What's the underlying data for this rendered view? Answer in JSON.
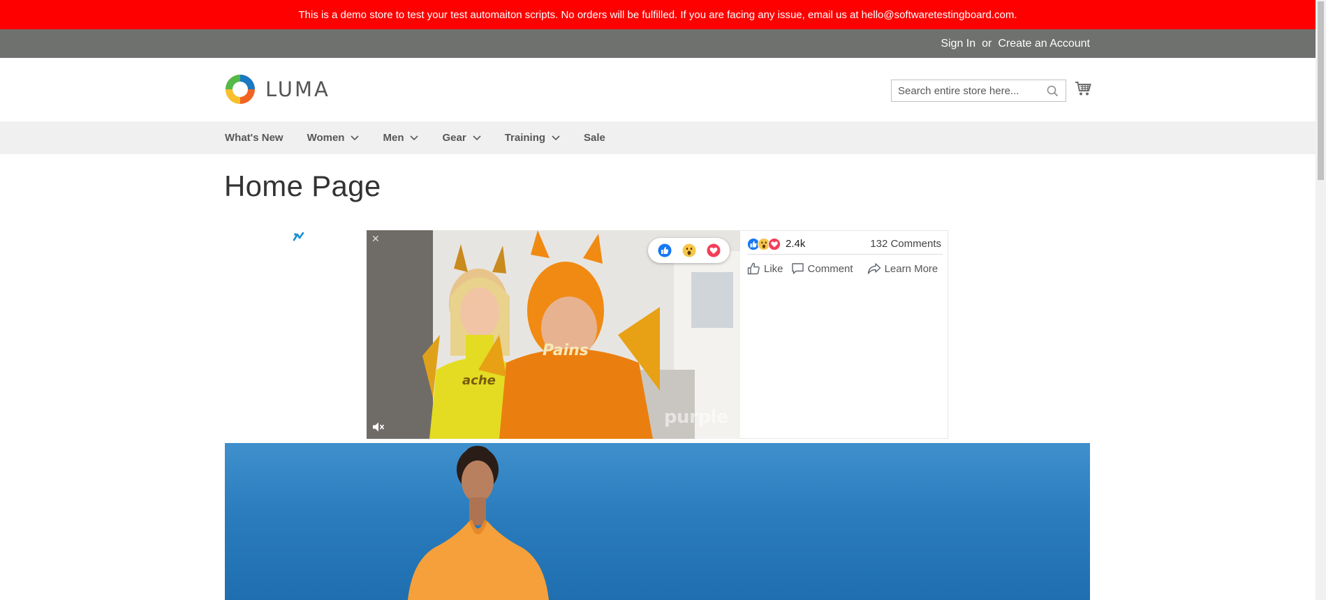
{
  "demo_banner": {
    "text": "This is a demo store to test your test automaiton scripts. No orders will be fulfilled. If you are facing any issue, email us at hello@softwaretestingboard.com."
  },
  "top_bar": {
    "sign_in": "Sign In",
    "or": "or",
    "create_account": "Create an Account"
  },
  "header": {
    "logo_text": "LUMA",
    "search_placeholder": "Search entire store here...",
    "search_value": ""
  },
  "nav": {
    "items": [
      {
        "label": "What's New",
        "has_dropdown": false
      },
      {
        "label": "Women",
        "has_dropdown": true
      },
      {
        "label": "Men",
        "has_dropdown": true
      },
      {
        "label": "Gear",
        "has_dropdown": true
      },
      {
        "label": "Training",
        "has_dropdown": true
      },
      {
        "label": "Sale",
        "has_dropdown": false
      }
    ]
  },
  "page": {
    "title": "Home Page"
  },
  "video_ad": {
    "close_glyph": "✕",
    "watermark": "purple",
    "shirt_left": "ache",
    "shirt_right": "Pains"
  },
  "social": {
    "reaction_count": "2.4k",
    "comments_count": "132 Comments",
    "actions": {
      "like": "Like",
      "comment": "Comment",
      "learn_more": "Learn More"
    }
  },
  "colors": {
    "banner_red": "#ff0000",
    "top_bar_gray": "#6e716e",
    "nav_bg": "#f0f0f0",
    "like_blue": "#1877f2",
    "love_red": "#f33e58",
    "hero_blue": "#2a7cbd"
  }
}
